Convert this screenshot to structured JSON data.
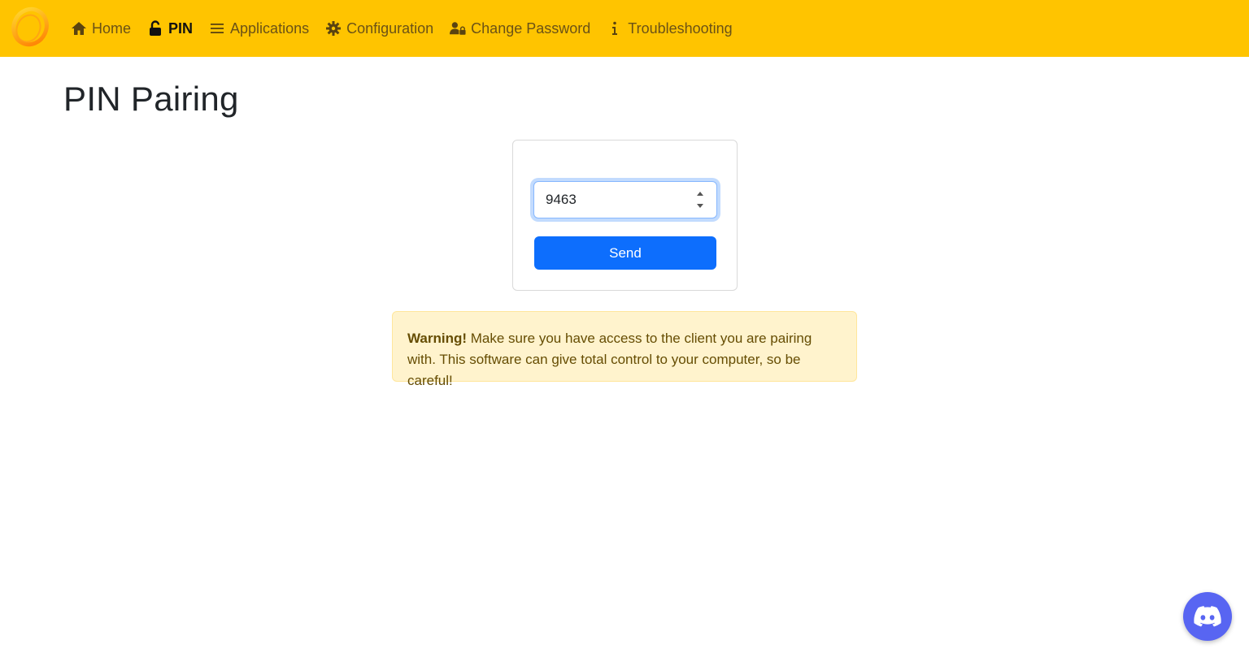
{
  "navbar": {
    "logo_icon": "sunshine-logo-icon",
    "items": [
      {
        "label": "Home",
        "icon": "home-icon",
        "active": false
      },
      {
        "label": "PIN",
        "icon": "unlock-icon",
        "active": true
      },
      {
        "label": "Applications",
        "icon": "list-icon",
        "active": false
      },
      {
        "label": "Configuration",
        "icon": "gear-icon",
        "active": false
      },
      {
        "label": "Change Password",
        "icon": "user-lock-icon",
        "active": false
      },
      {
        "label": "Troubleshooting",
        "icon": "info-icon",
        "active": false
      }
    ],
    "background_color": "#ffc400"
  },
  "page": {
    "title": "PIN Pairing"
  },
  "form": {
    "pin_value": "9463",
    "send_label": "Send",
    "send_color": "#0d6efd"
  },
  "alert": {
    "strong": "Warning!",
    "message": "Make sure you have access to the client you are pairing with. This software can give total control to your computer, so be careful!"
  },
  "discord": {
    "icon": "discord-icon",
    "color": "#5865f2"
  }
}
